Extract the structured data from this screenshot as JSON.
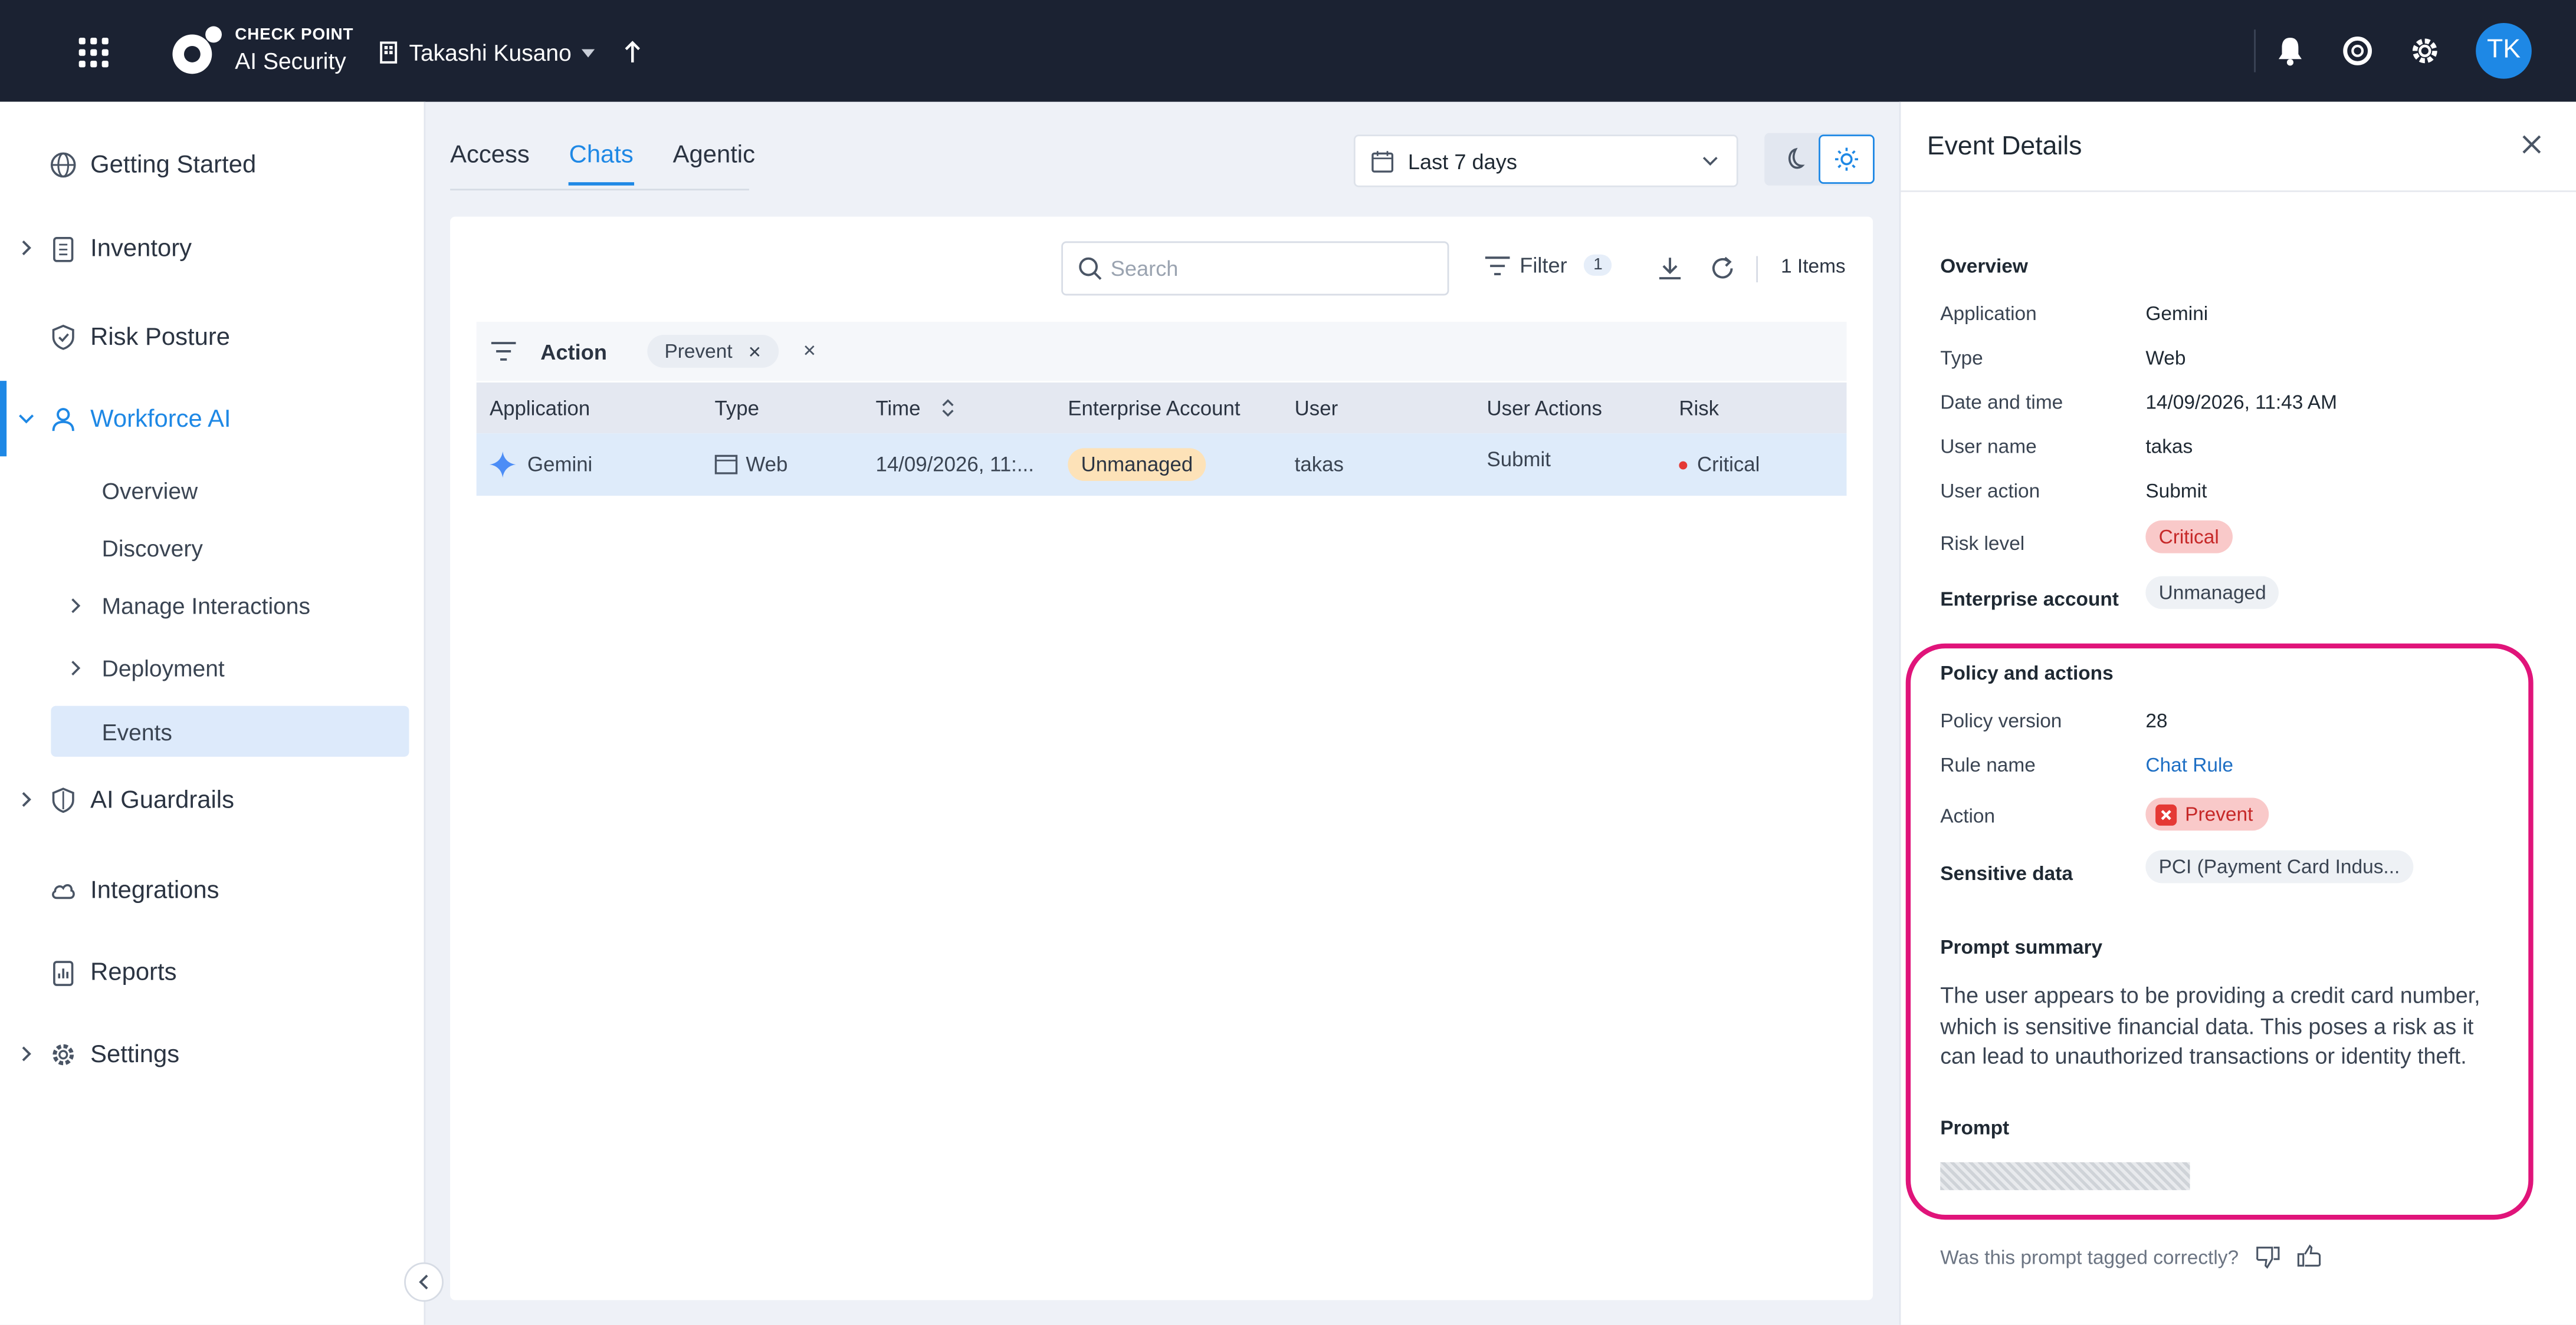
{
  "topbar": {
    "brand_line1": "CHECK POINT",
    "brand_line2": "AI Security",
    "tenant_name": "Takashi Kusano",
    "avatar_initials": "TK"
  },
  "sidebar": {
    "items": [
      {
        "label": "Getting Started"
      },
      {
        "label": "Inventory"
      },
      {
        "label": "Risk Posture"
      },
      {
        "label": "Workforce AI"
      },
      {
        "label": "AI Guardrails"
      },
      {
        "label": "Integrations"
      },
      {
        "label": "Reports"
      },
      {
        "label": "Settings"
      }
    ],
    "subitems": [
      {
        "label": "Overview"
      },
      {
        "label": "Discovery"
      },
      {
        "label": "Manage Interactions"
      },
      {
        "label": "Deployment"
      },
      {
        "label": "Events"
      }
    ]
  },
  "main": {
    "tabs": [
      {
        "label": "Access"
      },
      {
        "label": "Chats"
      },
      {
        "label": "Agentic"
      }
    ],
    "date_range": "Last 7 days",
    "search_placeholder": "Search",
    "filter_label": "Filter",
    "filter_count": "1",
    "items_count": "1 Items",
    "filter_bar": {
      "field": "Action",
      "chip": "Prevent"
    },
    "table": {
      "headers": [
        "Application",
        "Type",
        "Time",
        "Enterprise Account",
        "User",
        "User Actions",
        "Risk"
      ],
      "rows": [
        {
          "application": "Gemini",
          "type": "Web",
          "time": "14/09/2026, 11:...",
          "account": "Unmanaged",
          "user": "takas",
          "user_action": "Submit",
          "risk": "Critical"
        }
      ]
    }
  },
  "panel": {
    "title": "Event Details",
    "overview": {
      "heading": "Overview",
      "application_label": "Application",
      "application": "Gemini",
      "type_label": "Type",
      "type": "Web",
      "datetime_label": "Date and time",
      "datetime": "14/09/2026, 11:43 AM",
      "username_label": "User name",
      "username": "takas",
      "useraction_label": "User action",
      "useraction": "Submit",
      "risk_label": "Risk level",
      "risk": "Critical",
      "enterprise_label": "Enterprise account",
      "enterprise": "Unmanaged"
    },
    "policy": {
      "heading": "Policy and actions",
      "version_label": "Policy version",
      "version": "28",
      "rule_label": "Rule name",
      "rule": "Chat Rule",
      "action_label": "Action",
      "action": "Prevent",
      "sensitive_label": "Sensitive data",
      "sensitive": "PCI (Payment Card Indus..."
    },
    "prompt_summary_heading": "Prompt summary",
    "prompt_summary": "The user appears to be providing a credit card number, which is sensitive financial data. This poses a risk as it can lead to unauthorized transactions or identity theft.",
    "prompt_heading": "Prompt",
    "feedback_question": "Was this prompt tagged correctly?"
  },
  "colors": {
    "accent": "#1e88e5",
    "topbar": "#1b2232",
    "critical": "#c62828",
    "highlight": "#e0147a"
  }
}
